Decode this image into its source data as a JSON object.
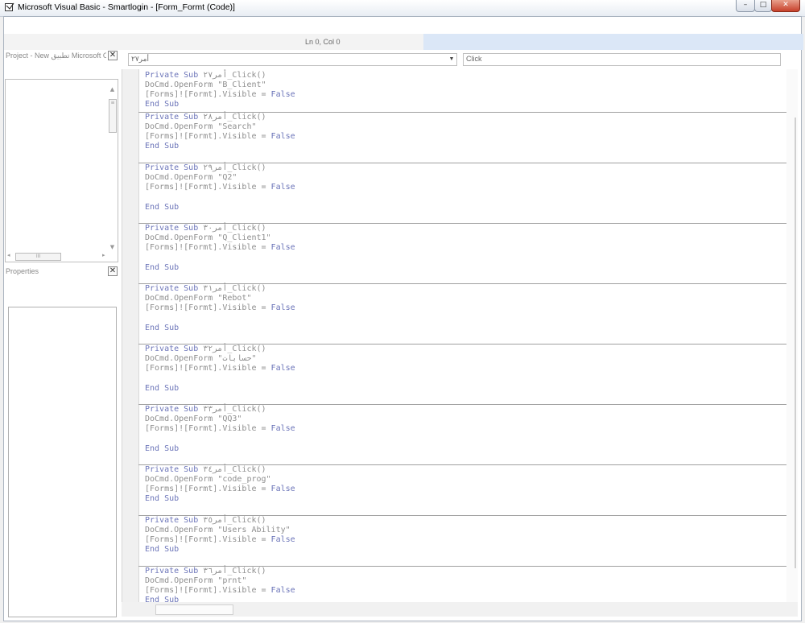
{
  "window": {
    "title": "Microsoft Visual Basic - Smartlogin - [Form_Formt (Code)]",
    "controls": {
      "minimize": "–",
      "maximize": "□",
      "close": "✕"
    }
  },
  "status": {
    "position": "Ln 0, Col 0"
  },
  "project_pane": {
    "title": "Project - New تطبيق Microsoft O",
    "close_glyph": "✕",
    "scroll_up": "▲",
    "scroll_down": "▼",
    "thumb_grip": "≡",
    "hthumb_grip": "III",
    "scroll_left": "◂",
    "scroll_right": "▸"
  },
  "properties_pane": {
    "title": "Properties",
    "close_glyph": "✕"
  },
  "object_combo": {
    "value": "أمر٢٧",
    "arrow": "▼"
  },
  "procedure_combo": {
    "value": "Click"
  },
  "procedures": [
    {
      "name": "أمر٢٧",
      "form": "B_Client"
    },
    {
      "name": "أمر٢٨",
      "form": "Search"
    },
    {
      "name": "أمر٢٩",
      "form": "Q2"
    },
    {
      "name": "أمر٣٠",
      "form": "Q_Client1"
    },
    {
      "name": "أمر٣١",
      "form": "Rebot"
    },
    {
      "name": "أمر٣٢",
      "form": "حسابات"
    },
    {
      "name": "أمر٣٣",
      "form": "QQ3"
    },
    {
      "name": "أمر٣٤",
      "form": "code_prog"
    },
    {
      "name": "أمر٣٥",
      "form": "Users Ability"
    },
    {
      "name": "أمر٣٦",
      "form": "prnt"
    }
  ],
  "code": {
    "kw_private_sub": "Private Sub",
    "click_suffix": "_Click()",
    "docmd_prefix": "DoCmd.OpenForm ",
    "forms_stmt": "[Forms]![Formt].Visible = ",
    "kw_false": "False",
    "kw_end_sub": "End Sub"
  }
}
